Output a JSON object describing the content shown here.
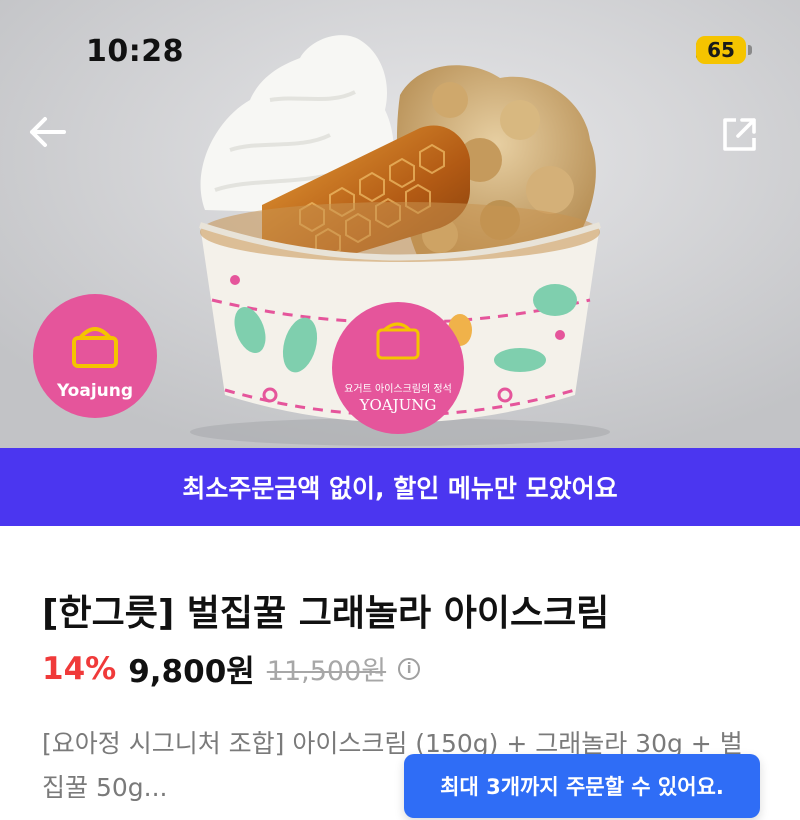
{
  "status_bar": {
    "time": "10:28",
    "battery_level": "65",
    "icons": [
      "signal-icon",
      "wifi-icon",
      "battery-icon"
    ],
    "battery_color": "#f5c400"
  },
  "header": {
    "back_icon": "arrow-left-icon",
    "share_icon": "share-icon"
  },
  "hero": {
    "brand_logo_text": "Yoajung",
    "cup_label_small": "요거트 아이스크림의 정석",
    "cup_label_brand": "YOAJUNG"
  },
  "banner": {
    "text": "최소주문금액 없이, 할인 메뉴만 모았어요",
    "background": "#4b36f0"
  },
  "product": {
    "title": "[한그릇] 벌집꿀 그래놀라 아이스크림",
    "discount": "14%",
    "price": "9,800원",
    "original_price": "11,500원",
    "description": "[요아정 시그니처 조합] 아이스크림 (150g) + 그래놀라 30g + 벌집꿀 50g..."
  },
  "toast": {
    "text": "최대 3개까지 주문할 수 있어요.",
    "background": "#2f6df6"
  },
  "colors": {
    "discount": "#f03a3a",
    "logo_pink": "#e5559b"
  }
}
